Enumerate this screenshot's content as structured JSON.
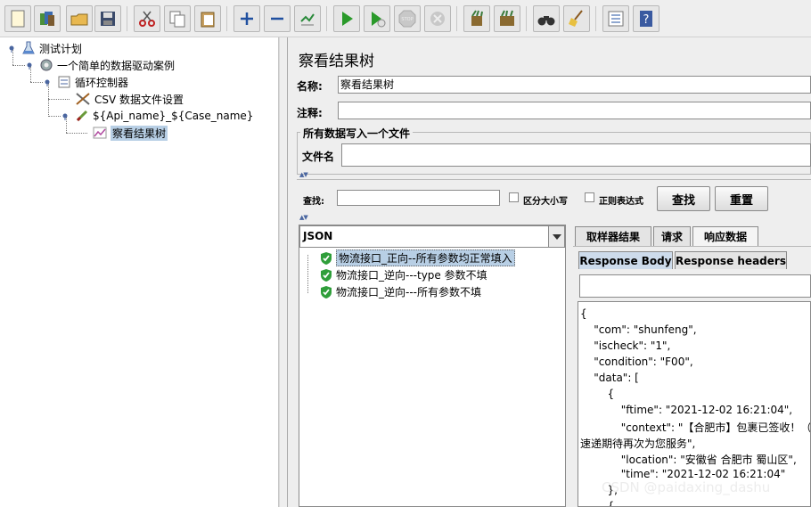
{
  "tree": {
    "items": [
      {
        "label": "测试计划",
        "icon": "test-plan-icon"
      },
      {
        "label": "一个简单的数据驱动案例",
        "icon": "thread-group-gear-icon"
      },
      {
        "label": "循环控制器",
        "icon": "loop-controller-icon"
      },
      {
        "label": "CSV 数据文件设置",
        "icon": "csv-tools-icon"
      },
      {
        "label": "${Api_name}_${Case_name}",
        "icon": "http-sampler-icon"
      },
      {
        "label": "察看结果树",
        "icon": "results-tree-icon"
      }
    ]
  },
  "panel": {
    "title": "察看结果树",
    "name_label": "名称:",
    "name_value": "察看结果树",
    "comment_label": "注释:",
    "comment_value": "",
    "group_title": "所有数据写入一个文件",
    "filename_label": "文件名",
    "filename_value": ""
  },
  "search": {
    "label": "查找:",
    "value": "",
    "case_label": "区分大小写",
    "regex_label": "正则表达式",
    "find_button": "查找",
    "reset_button": "重置"
  },
  "renderer": {
    "selected": "JSON"
  },
  "results": [
    {
      "label": "物流接口_正向--所有参数均正常填入",
      "status": "success"
    },
    {
      "label": "物流接口_逆向---type 参数不填",
      "status": "success"
    },
    {
      "label": "物流接口_逆向---所有参数不填",
      "status": "success"
    }
  ],
  "tabs": [
    "取样器结果",
    "请求",
    "响应数据"
  ],
  "subtabs": [
    "Response Body",
    "Response headers"
  ],
  "response_lines": [
    "{",
    "    \"com\": \"shunfeng\",",
    "    \"ischeck\": \"1\",",
    "    \"condition\": \"F00\",",
    "    \"data\": [",
    "        {",
    "            \"ftime\": \"2021-12-02 16:21:04\",",
    "            \"context\": \"【合肥市】包裹已签收！（凭取",
    "速递期待再次为您服务\",",
    "            \"location\": \"安徽省 合肥市 蜀山区\",",
    "            \"time\": \"2021-12-02 16:21:04\"",
    "        },",
    "        {"
  ],
  "watermark": "CSDN @paidaxing_dashu",
  "colors": {
    "selection": "#b8cfe5",
    "accent": "#4a66a0",
    "success": "#2f9e3a"
  }
}
